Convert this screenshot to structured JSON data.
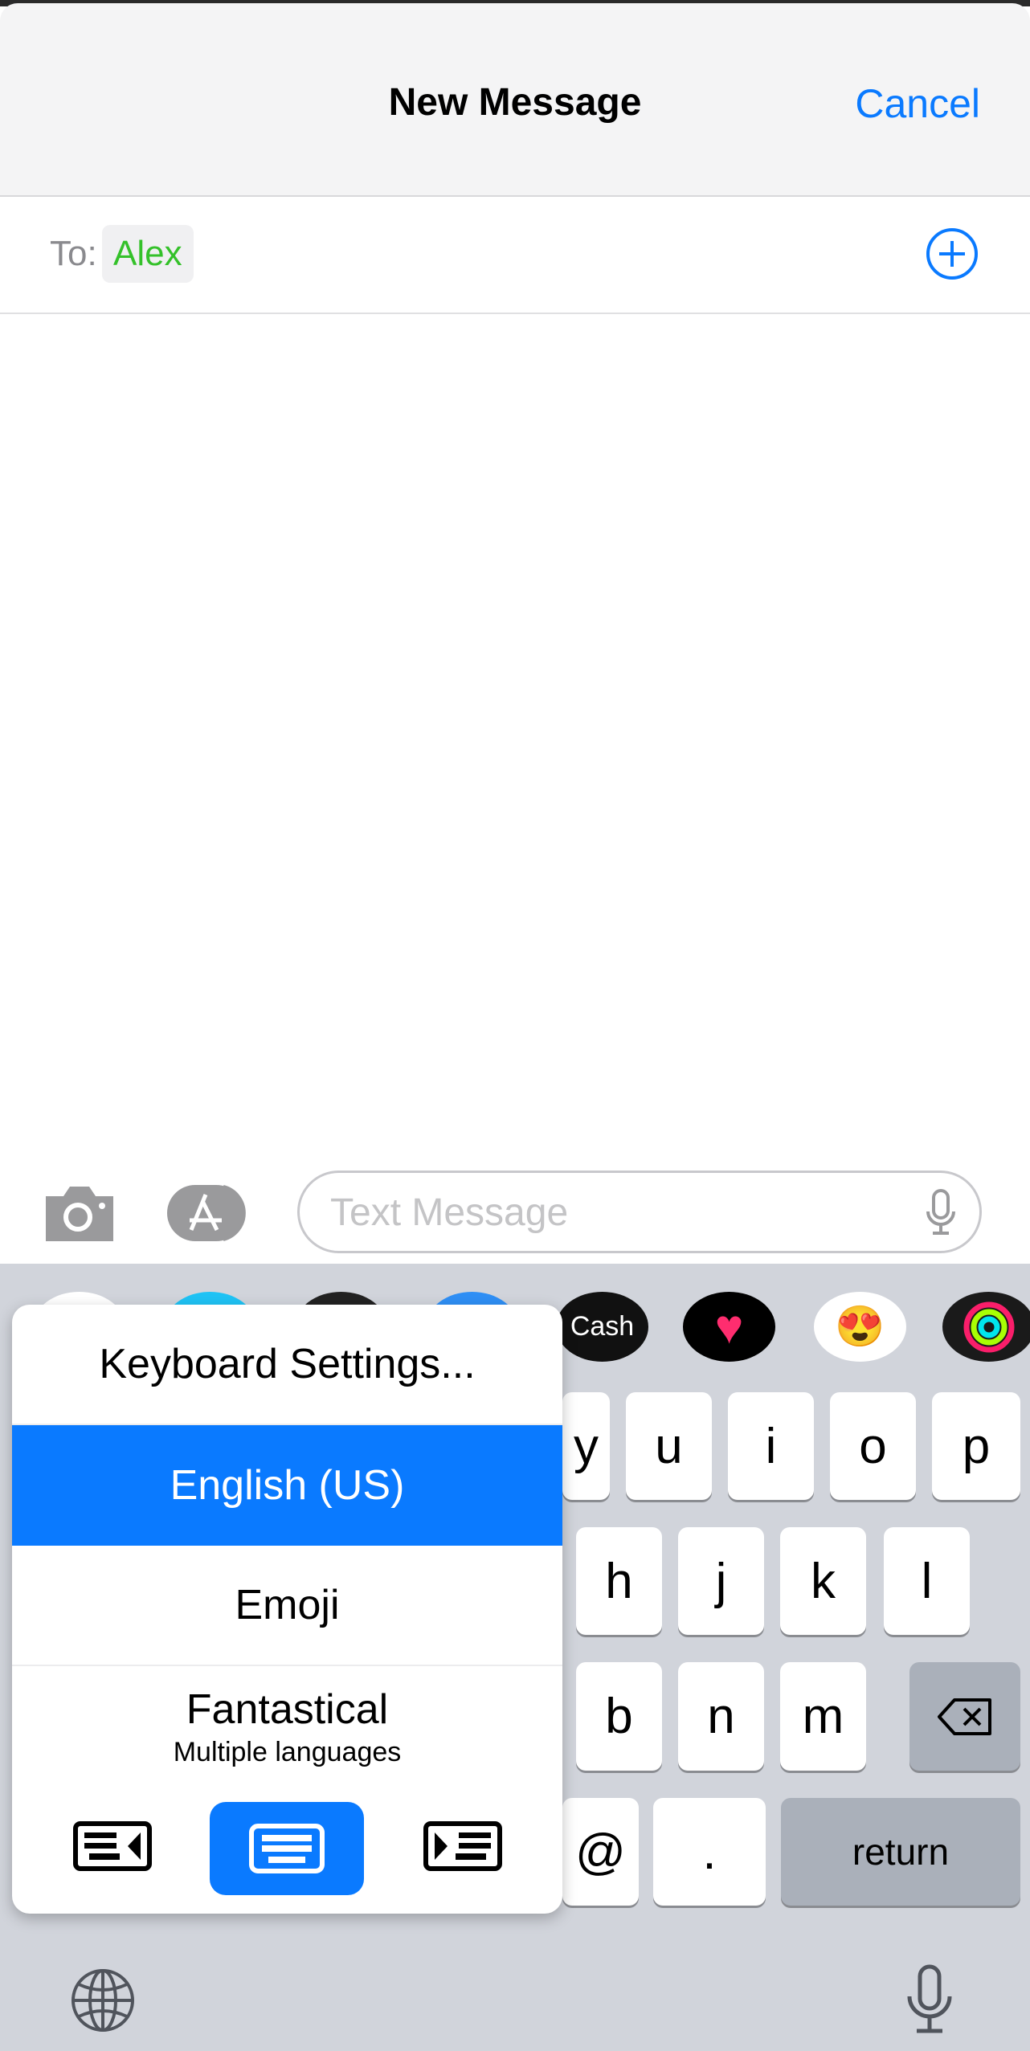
{
  "header": {
    "title": "New Message",
    "cancel_label": "Cancel"
  },
  "to_field": {
    "label": "To:",
    "recipient": "Alex"
  },
  "compose": {
    "placeholder": "Text Message"
  },
  "app_strip": {
    "items": [
      "partially-hidden-app",
      "partially-hidden-app",
      "partially-hidden-app",
      "partially-hidden-app",
      "Cash",
      "heart-app",
      "memoji",
      "activity"
    ],
    "cash_label": "Cash"
  },
  "keyboard_menu": {
    "items": [
      {
        "label": "Keyboard Settings..."
      },
      {
        "label": "English (US)",
        "selected": true
      },
      {
        "label": "Emoji"
      },
      {
        "label": "Fantastical",
        "sublabel": "Multiple languages"
      }
    ],
    "layout_options": [
      "keyboard-left-icon",
      "keyboard-full-icon",
      "keyboard-right-icon"
    ],
    "selected_layout": "keyboard-full-icon"
  },
  "keys": {
    "row1": [
      "y",
      "u",
      "i",
      "o",
      "p"
    ],
    "row2": [
      "h",
      "j",
      "k",
      "l"
    ],
    "row3": [
      "b",
      "n",
      "m"
    ],
    "row4": [
      "@",
      "."
    ],
    "return_label": "return"
  },
  "colors": {
    "accent": "#0a7aff",
    "recipient": "#34c12a",
    "keyboard_bg": "#d1d4db"
  }
}
